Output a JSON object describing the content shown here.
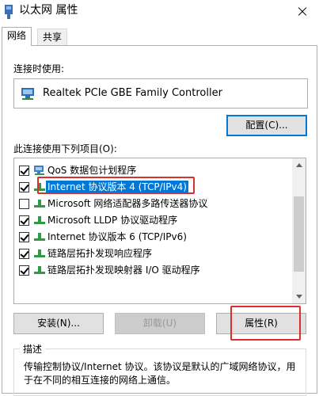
{
  "window": {
    "title": "以太网 属性"
  },
  "tabs": [
    {
      "label": "网络",
      "active": true
    },
    {
      "label": "共享",
      "active": false
    }
  ],
  "connect_using": {
    "label": "连接时使用:",
    "adapter": "Realtek PCIe GBE Family Controller",
    "configure_button": "配置(C)..."
  },
  "items_section": {
    "label": "此连接使用下列项目(O):",
    "items": [
      {
        "label": "QoS 数据包计划程序",
        "checked": true,
        "icon": "network-icon"
      },
      {
        "label": "Internet 协议版本 4 (TCP/IPv4)",
        "checked": true,
        "icon": "protocol-icon",
        "selected": true
      },
      {
        "label": "Microsoft 网络适配器多路传送器协议",
        "checked": false,
        "icon": "protocol-icon"
      },
      {
        "label": "Microsoft LLDP 协议驱动程序",
        "checked": true,
        "icon": "protocol-icon"
      },
      {
        "label": "Internet 协议版本 6 (TCP/IPv6)",
        "checked": true,
        "icon": "protocol-icon"
      },
      {
        "label": "链路层拓扑发现响应程序",
        "checked": true,
        "icon": "protocol-icon"
      },
      {
        "label": "链路层拓扑发现映射器 I/O 驱动程序",
        "checked": true,
        "icon": "protocol-icon"
      }
    ]
  },
  "buttons": {
    "install": "安装(N)...",
    "uninstall": "卸载(U)",
    "properties": "属性(R)"
  },
  "description": {
    "title": "描述",
    "text": "传输控制协议/Internet 协议。该协议是默认的广域网络协议，用于在不同的相互连接的网络上通信。"
  },
  "colors": {
    "selection": "#0078d7",
    "highlight_annotation": "#d9302c"
  }
}
